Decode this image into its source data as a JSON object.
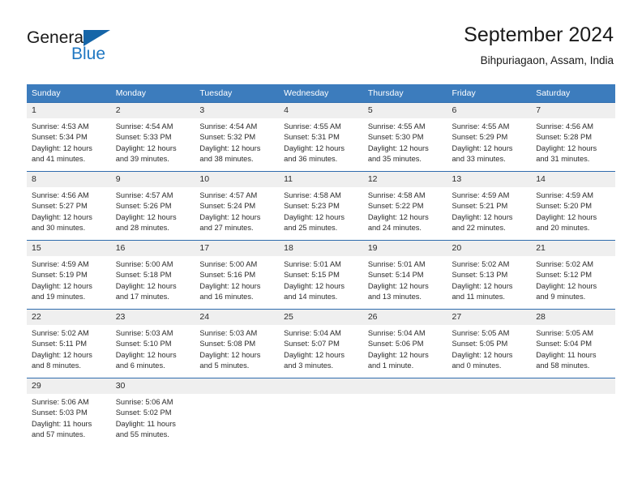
{
  "brand": {
    "word_one": "General",
    "word_two": "Blue",
    "accent_color": "#1f77c2",
    "triangle_color": "#1565a8",
    "logo_icon": "triangle-icon"
  },
  "header": {
    "title": "September 2024",
    "subtitle": "Bihpuriagaon, Assam, India"
  },
  "calendar": {
    "header_bg": "#3c7cbd",
    "daynum_bg": "#efefef",
    "row_border_color": "#2f6cad",
    "weekdays": [
      "Sunday",
      "Monday",
      "Tuesday",
      "Wednesday",
      "Thursday",
      "Friday",
      "Saturday"
    ],
    "weeks": [
      [
        {
          "day": "1",
          "sunrise": "Sunrise: 4:53 AM",
          "sunset": "Sunset: 5:34 PM",
          "daylight_line1": "Daylight: 12 hours",
          "daylight_line2": "and 41 minutes."
        },
        {
          "day": "2",
          "sunrise": "Sunrise: 4:54 AM",
          "sunset": "Sunset: 5:33 PM",
          "daylight_line1": "Daylight: 12 hours",
          "daylight_line2": "and 39 minutes."
        },
        {
          "day": "3",
          "sunrise": "Sunrise: 4:54 AM",
          "sunset": "Sunset: 5:32 PM",
          "daylight_line1": "Daylight: 12 hours",
          "daylight_line2": "and 38 minutes."
        },
        {
          "day": "4",
          "sunrise": "Sunrise: 4:55 AM",
          "sunset": "Sunset: 5:31 PM",
          "daylight_line1": "Daylight: 12 hours",
          "daylight_line2": "and 36 minutes."
        },
        {
          "day": "5",
          "sunrise": "Sunrise: 4:55 AM",
          "sunset": "Sunset: 5:30 PM",
          "daylight_line1": "Daylight: 12 hours",
          "daylight_line2": "and 35 minutes."
        },
        {
          "day": "6",
          "sunrise": "Sunrise: 4:55 AM",
          "sunset": "Sunset: 5:29 PM",
          "daylight_line1": "Daylight: 12 hours",
          "daylight_line2": "and 33 minutes."
        },
        {
          "day": "7",
          "sunrise": "Sunrise: 4:56 AM",
          "sunset": "Sunset: 5:28 PM",
          "daylight_line1": "Daylight: 12 hours",
          "daylight_line2": "and 31 minutes."
        }
      ],
      [
        {
          "day": "8",
          "sunrise": "Sunrise: 4:56 AM",
          "sunset": "Sunset: 5:27 PM",
          "daylight_line1": "Daylight: 12 hours",
          "daylight_line2": "and 30 minutes."
        },
        {
          "day": "9",
          "sunrise": "Sunrise: 4:57 AM",
          "sunset": "Sunset: 5:26 PM",
          "daylight_line1": "Daylight: 12 hours",
          "daylight_line2": "and 28 minutes."
        },
        {
          "day": "10",
          "sunrise": "Sunrise: 4:57 AM",
          "sunset": "Sunset: 5:24 PM",
          "daylight_line1": "Daylight: 12 hours",
          "daylight_line2": "and 27 minutes."
        },
        {
          "day": "11",
          "sunrise": "Sunrise: 4:58 AM",
          "sunset": "Sunset: 5:23 PM",
          "daylight_line1": "Daylight: 12 hours",
          "daylight_line2": "and 25 minutes."
        },
        {
          "day": "12",
          "sunrise": "Sunrise: 4:58 AM",
          "sunset": "Sunset: 5:22 PM",
          "daylight_line1": "Daylight: 12 hours",
          "daylight_line2": "and 24 minutes."
        },
        {
          "day": "13",
          "sunrise": "Sunrise: 4:59 AM",
          "sunset": "Sunset: 5:21 PM",
          "daylight_line1": "Daylight: 12 hours",
          "daylight_line2": "and 22 minutes."
        },
        {
          "day": "14",
          "sunrise": "Sunrise: 4:59 AM",
          "sunset": "Sunset: 5:20 PM",
          "daylight_line1": "Daylight: 12 hours",
          "daylight_line2": "and 20 minutes."
        }
      ],
      [
        {
          "day": "15",
          "sunrise": "Sunrise: 4:59 AM",
          "sunset": "Sunset: 5:19 PM",
          "daylight_line1": "Daylight: 12 hours",
          "daylight_line2": "and 19 minutes."
        },
        {
          "day": "16",
          "sunrise": "Sunrise: 5:00 AM",
          "sunset": "Sunset: 5:18 PM",
          "daylight_line1": "Daylight: 12 hours",
          "daylight_line2": "and 17 minutes."
        },
        {
          "day": "17",
          "sunrise": "Sunrise: 5:00 AM",
          "sunset": "Sunset: 5:16 PM",
          "daylight_line1": "Daylight: 12 hours",
          "daylight_line2": "and 16 minutes."
        },
        {
          "day": "18",
          "sunrise": "Sunrise: 5:01 AM",
          "sunset": "Sunset: 5:15 PM",
          "daylight_line1": "Daylight: 12 hours",
          "daylight_line2": "and 14 minutes."
        },
        {
          "day": "19",
          "sunrise": "Sunrise: 5:01 AM",
          "sunset": "Sunset: 5:14 PM",
          "daylight_line1": "Daylight: 12 hours",
          "daylight_line2": "and 13 minutes."
        },
        {
          "day": "20",
          "sunrise": "Sunrise: 5:02 AM",
          "sunset": "Sunset: 5:13 PM",
          "daylight_line1": "Daylight: 12 hours",
          "daylight_line2": "and 11 minutes."
        },
        {
          "day": "21",
          "sunrise": "Sunrise: 5:02 AM",
          "sunset": "Sunset: 5:12 PM",
          "daylight_line1": "Daylight: 12 hours",
          "daylight_line2": "and 9 minutes."
        }
      ],
      [
        {
          "day": "22",
          "sunrise": "Sunrise: 5:02 AM",
          "sunset": "Sunset: 5:11 PM",
          "daylight_line1": "Daylight: 12 hours",
          "daylight_line2": "and 8 minutes."
        },
        {
          "day": "23",
          "sunrise": "Sunrise: 5:03 AM",
          "sunset": "Sunset: 5:10 PM",
          "daylight_line1": "Daylight: 12 hours",
          "daylight_line2": "and 6 minutes."
        },
        {
          "day": "24",
          "sunrise": "Sunrise: 5:03 AM",
          "sunset": "Sunset: 5:08 PM",
          "daylight_line1": "Daylight: 12 hours",
          "daylight_line2": "and 5 minutes."
        },
        {
          "day": "25",
          "sunrise": "Sunrise: 5:04 AM",
          "sunset": "Sunset: 5:07 PM",
          "daylight_line1": "Daylight: 12 hours",
          "daylight_line2": "and 3 minutes."
        },
        {
          "day": "26",
          "sunrise": "Sunrise: 5:04 AM",
          "sunset": "Sunset: 5:06 PM",
          "daylight_line1": "Daylight: 12 hours",
          "daylight_line2": "and 1 minute."
        },
        {
          "day": "27",
          "sunrise": "Sunrise: 5:05 AM",
          "sunset": "Sunset: 5:05 PM",
          "daylight_line1": "Daylight: 12 hours",
          "daylight_line2": "and 0 minutes."
        },
        {
          "day": "28",
          "sunrise": "Sunrise: 5:05 AM",
          "sunset": "Sunset: 5:04 PM",
          "daylight_line1": "Daylight: 11 hours",
          "daylight_line2": "and 58 minutes."
        }
      ],
      [
        {
          "day": "29",
          "sunrise": "Sunrise: 5:06 AM",
          "sunset": "Sunset: 5:03 PM",
          "daylight_line1": "Daylight: 11 hours",
          "daylight_line2": "and 57 minutes."
        },
        {
          "day": "30",
          "sunrise": "Sunrise: 5:06 AM",
          "sunset": "Sunset: 5:02 PM",
          "daylight_line1": "Daylight: 11 hours",
          "daylight_line2": "and 55 minutes."
        },
        {
          "day": "",
          "sunrise": "",
          "sunset": "",
          "daylight_line1": "",
          "daylight_line2": ""
        },
        {
          "day": "",
          "sunrise": "",
          "sunset": "",
          "daylight_line1": "",
          "daylight_line2": ""
        },
        {
          "day": "",
          "sunrise": "",
          "sunset": "",
          "daylight_line1": "",
          "daylight_line2": ""
        },
        {
          "day": "",
          "sunrise": "",
          "sunset": "",
          "daylight_line1": "",
          "daylight_line2": ""
        },
        {
          "day": "",
          "sunrise": "",
          "sunset": "",
          "daylight_line1": "",
          "daylight_line2": ""
        }
      ]
    ]
  }
}
